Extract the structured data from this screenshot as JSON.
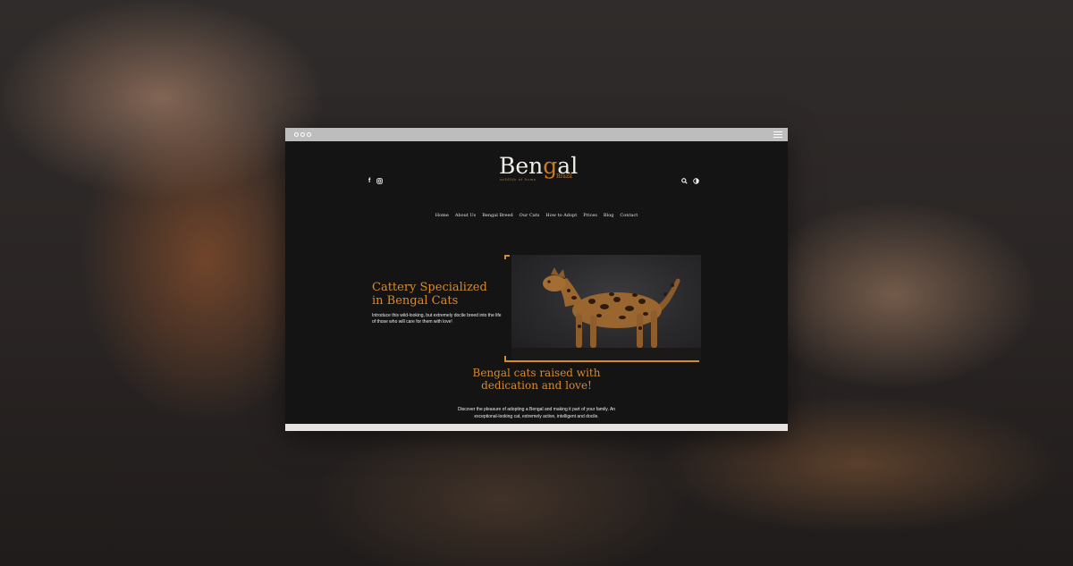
{
  "browser": {
    "menu_icon": "hamburger-icon"
  },
  "header": {
    "logo_prefix": "Ben",
    "logo_accent": "g",
    "logo_suffix": "al",
    "logo_tagline": "wildlife at home",
    "logo_country": "Brazil",
    "social_icons": [
      "facebook-icon",
      "instagram-icon"
    ],
    "tool_icons": [
      "search-icon",
      "contrast-icon"
    ]
  },
  "nav": {
    "items": [
      "Home",
      "About Us",
      "Bengal Breed",
      "Our Cats",
      "How to Adopt",
      "Prices",
      "Blog",
      "Contact"
    ]
  },
  "hero": {
    "title_line1": "Cattery Specialized",
    "title_line2": "in Bengal Cats",
    "text": "Introduce this wild-looking, but extremely docile breed into the life of those who will care for them with love!"
  },
  "section": {
    "title_line1": "Bengal cats raised with",
    "title_line2": "dedication and love!",
    "text": "Discover the pleasure of adopting a Bengal and making it part of your family. An exceptional-looking cat, extremely active, intelligent and docile."
  },
  "colors": {
    "accent": "#d78a2f",
    "page_bg": "#141414"
  }
}
